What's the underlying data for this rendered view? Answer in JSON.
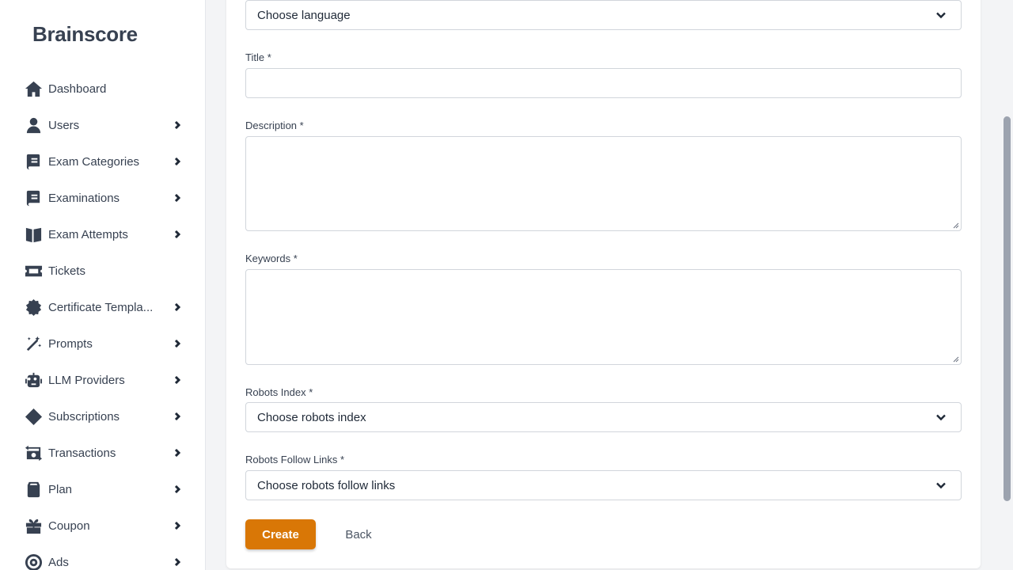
{
  "app": {
    "brand": "Brainscore"
  },
  "sidebar": {
    "items": [
      {
        "label": "Dashboard",
        "icon": "home-icon",
        "has_chevron": false
      },
      {
        "label": "Users",
        "icon": "user-icon",
        "has_chevron": true
      },
      {
        "label": "Exam Categories",
        "icon": "book-icon",
        "has_chevron": true
      },
      {
        "label": "Examinations",
        "icon": "book-icon",
        "has_chevron": true
      },
      {
        "label": "Exam Attempts",
        "icon": "book-open-icon",
        "has_chevron": true
      },
      {
        "label": "Tickets",
        "icon": "ticket-icon",
        "has_chevron": false
      },
      {
        "label": "Certificate Templa...",
        "icon": "certificate-icon",
        "has_chevron": true
      },
      {
        "label": "Prompts",
        "icon": "magic-wand-icon",
        "has_chevron": true
      },
      {
        "label": "LLM Providers",
        "icon": "robot-icon",
        "has_chevron": true
      },
      {
        "label": "Subscriptions",
        "icon": "diamond-icon",
        "has_chevron": true
      },
      {
        "label": "Transactions",
        "icon": "money-transfer-icon",
        "has_chevron": true
      },
      {
        "label": "Plan",
        "icon": "box-icon",
        "has_chevron": true
      },
      {
        "label": "Coupon",
        "icon": "gift-icon",
        "has_chevron": true
      },
      {
        "label": "Ads",
        "icon": "bullseye-icon",
        "has_chevron": true
      }
    ]
  },
  "form": {
    "language_select": {
      "value": "Choose language"
    },
    "title": {
      "label": "Title *",
      "value": ""
    },
    "description": {
      "label": "Description *",
      "value": ""
    },
    "keywords": {
      "label": "Keywords *",
      "value": ""
    },
    "robots_index": {
      "label": "Robots Index *",
      "value": "Choose robots index"
    },
    "robots_follow": {
      "label": "Robots Follow Links *",
      "value": "Choose robots follow links"
    },
    "create_label": "Create",
    "back_label": "Back"
  },
  "colors": {
    "accent": "#d97706",
    "text": "#374151",
    "border": "#d1d5db"
  }
}
